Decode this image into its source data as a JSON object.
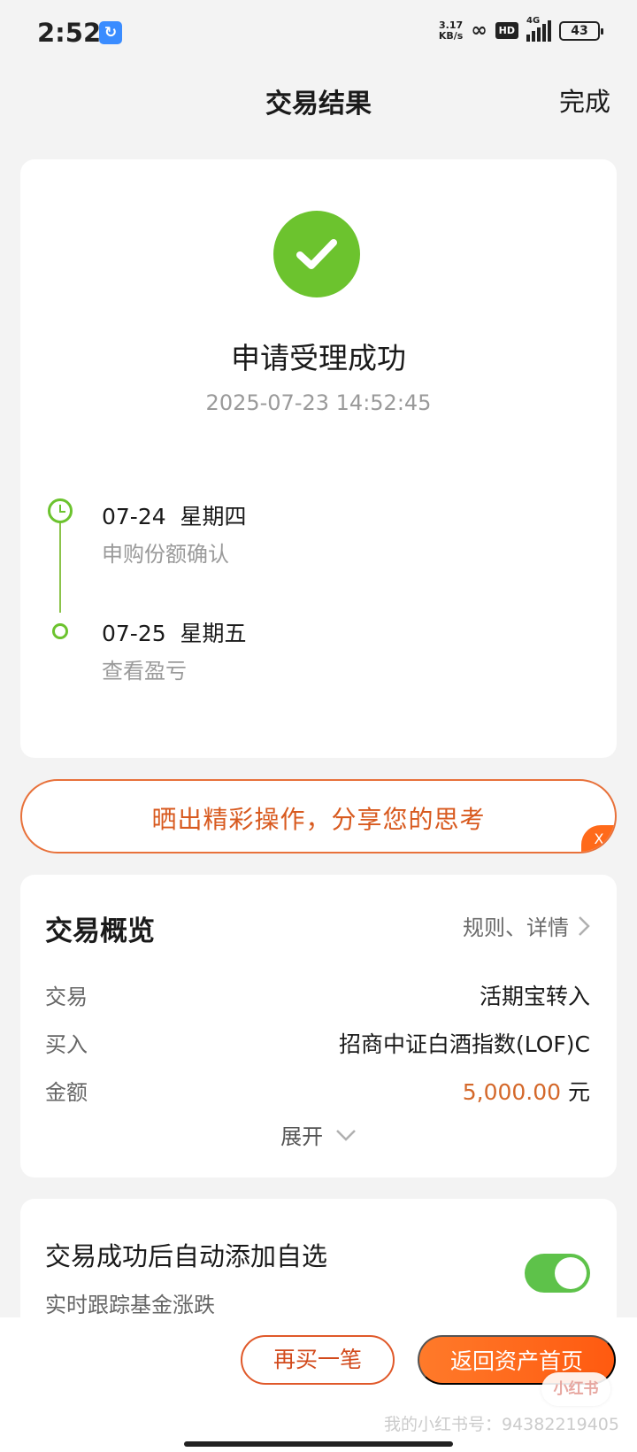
{
  "status_bar": {
    "time": "2:52",
    "speed_value": "3.17",
    "speed_unit": "KB/s",
    "hd": "HD",
    "network": "4G",
    "battery": "43"
  },
  "nav": {
    "title": "交易结果",
    "done_label": "完成"
  },
  "result": {
    "title": "申请受理成功",
    "time": "2025-07-23 14:52:45",
    "timeline": [
      {
        "date": "07-24  星期四",
        "desc": "申购份额确认"
      },
      {
        "date": "07-25  星期五",
        "desc": "查看盈亏"
      }
    ]
  },
  "share": {
    "text": "晒出精彩操作，分享您的思考",
    "close": "X"
  },
  "overview": {
    "title": "交易概览",
    "link": "规则、详情",
    "rows": [
      {
        "label": "交易",
        "value": "活期宝转入"
      },
      {
        "label": "买入",
        "value": "招商中证白酒指数(LOF)C"
      },
      {
        "label": "金额",
        "amount": "5,000.00",
        "unit": " 元"
      }
    ],
    "expand": "展开"
  },
  "auto_add": {
    "title": "交易成功后自动添加自选",
    "subtitle": "实时跟踪基金涨跌",
    "enabled": true
  },
  "actions": {
    "buy_again": "再买一笔",
    "back_home": "返回资产首页"
  },
  "watermark": {
    "badge": "小红书",
    "text": "我的小红书号：94382219405"
  },
  "colors": {
    "success_green": "#6cc32e",
    "accent_orange": "#ff5a10",
    "amount_orange": "#d4682a",
    "toggle_green": "#5ec24a"
  }
}
